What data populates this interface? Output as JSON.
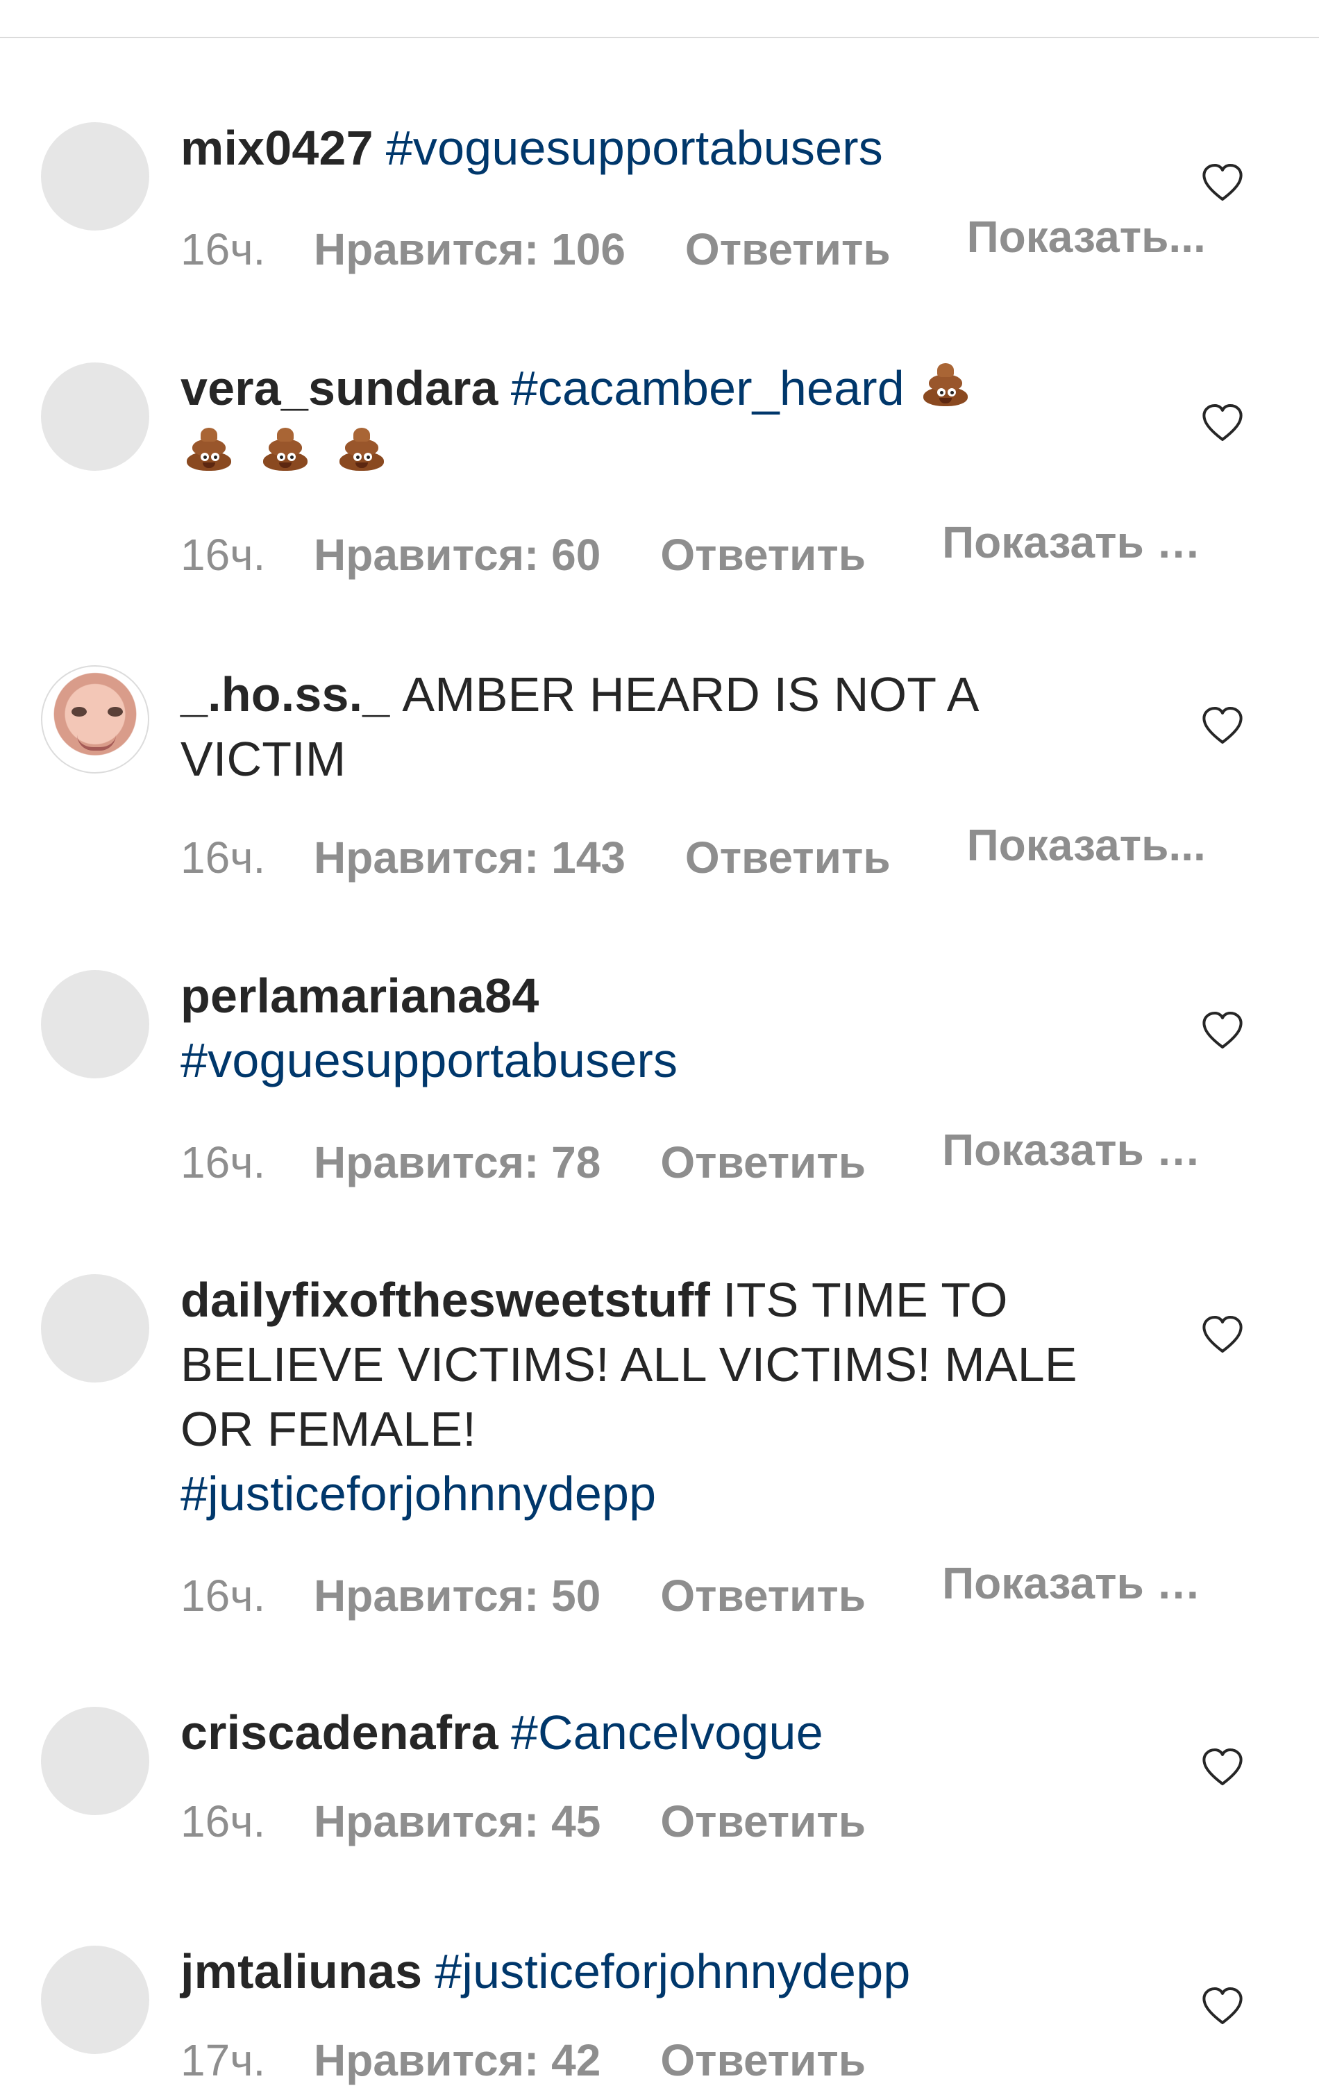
{
  "comments": [
    {
      "username": "mix0427",
      "text": "",
      "hashtag": "#voguesupportabusers",
      "emoji": [],
      "time": "16ч.",
      "likes": "Нравится: 106",
      "reply": "Ответить",
      "show": "Показать..."
    },
    {
      "username": "vera_sundara",
      "text": "",
      "hashtag": "#cacamber_heard",
      "emoji": [
        "pile-of-poo-icon",
        "pile-of-poo-icon",
        "pile-of-poo-icon",
        "pile-of-poo-icon"
      ],
      "time": "16ч.",
      "likes": "Нравится: 60",
      "reply": "Ответить",
      "show": "Показать п..."
    },
    {
      "username": "_.ho.ss._",
      "text": "AMBER HEARD IS NOT A VICTIM",
      "hashtag": "",
      "emoji": [],
      "time": "16ч.",
      "likes": "Нравится: 143",
      "reply": "Ответить",
      "show": "Показать..."
    },
    {
      "username": "perlamariana84",
      "text": "",
      "hashtag": "#voguesupportabusers",
      "emoji": [],
      "time": "16ч.",
      "likes": "Нравится: 78",
      "reply": "Ответить",
      "show": "Показать п..."
    },
    {
      "username": "dailyfixofthesweetstuff",
      "text": "ITS TIME TO BELIEVE VICTIMS! ALL VICTIMS! MALE OR FEMALE!",
      "hashtag": "#justiceforjohnnydepp",
      "emoji": [],
      "time": "16ч.",
      "likes": "Нравится: 50",
      "reply": "Ответить",
      "show": "Показать п..."
    },
    {
      "username": "criscadenafra",
      "text": "",
      "hashtag": "#Cancelvogue",
      "emoji": [],
      "time": "16ч.",
      "likes": "Нравится: 45",
      "reply": "Ответить",
      "show": ""
    },
    {
      "username": "jmtaliunas",
      "text": "",
      "hashtag": "#justiceforjohnnydepp",
      "emoji": [],
      "time": "17ч.",
      "likes": "Нравится: 42",
      "reply": "Ответить",
      "show": ""
    }
  ],
  "icons": {
    "heart": "heart-outline-icon",
    "avatar_placeholder": "avatar-placeholder",
    "avatar_photo": "profile-photo"
  },
  "colors": {
    "background": "#ffffff",
    "text": "#262626",
    "hashtag": "#00376b",
    "meta": "#8e8e8e",
    "avatar_placeholder": "#e6e6e6",
    "divider": "#dbdbdb"
  }
}
